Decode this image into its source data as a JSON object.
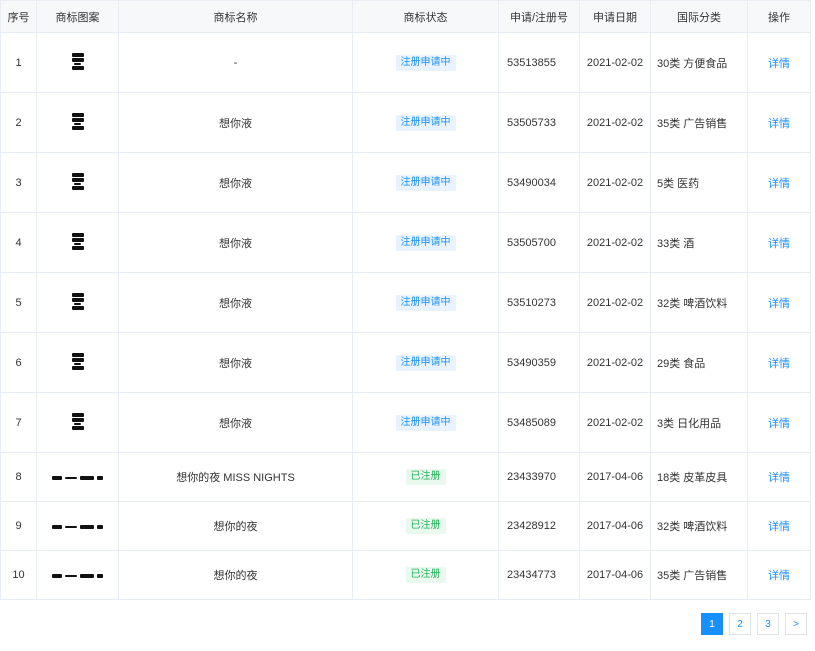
{
  "table": {
    "headers": [
      "序号",
      "商标图案",
      "商标名称",
      "商标状态",
      "申请/注册号",
      "申请日期",
      "国际分类",
      "操作"
    ],
    "rows": [
      {
        "index": "1",
        "logo": "vertical-text-logo",
        "name": "-",
        "status": "注册申请中",
        "status_type": "pending",
        "number": "53513855",
        "date": "2021-02-02",
        "category": "30类 方便食品",
        "action": "详情"
      },
      {
        "index": "2",
        "logo": "vertical-text-logo",
        "name": "想你液",
        "status": "注册申请中",
        "status_type": "pending",
        "number": "53505733",
        "date": "2021-02-02",
        "category": "35类 广告销售",
        "action": "详情"
      },
      {
        "index": "3",
        "logo": "vertical-text-logo",
        "name": "想你液",
        "status": "注册申请中",
        "status_type": "pending",
        "number": "53490034",
        "date": "2021-02-02",
        "category": "5类 医药",
        "action": "详情"
      },
      {
        "index": "4",
        "logo": "vertical-text-logo",
        "name": "想你液",
        "status": "注册申请中",
        "status_type": "pending",
        "number": "53505700",
        "date": "2021-02-02",
        "category": "33类 酒",
        "action": "详情"
      },
      {
        "index": "5",
        "logo": "vertical-text-logo",
        "name": "想你液",
        "status": "注册申请中",
        "status_type": "pending",
        "number": "53510273",
        "date": "2021-02-02",
        "category": "32类 啤酒饮料",
        "action": "详情"
      },
      {
        "index": "6",
        "logo": "vertical-text-logo",
        "name": "想你液",
        "status": "注册申请中",
        "status_type": "pending",
        "number": "53490359",
        "date": "2021-02-02",
        "category": "29类 食品",
        "action": "详情"
      },
      {
        "index": "7",
        "logo": "vertical-text-logo",
        "name": "想你液",
        "status": "注册申请中",
        "status_type": "pending",
        "number": "53485089",
        "date": "2021-02-02",
        "category": "3类 日化用品",
        "action": "详情"
      },
      {
        "index": "8",
        "logo": "horizontal-text-logo",
        "name": "想你的夜 MISS NIGHTS",
        "status": "已注册",
        "status_type": "registered",
        "number": "23433970",
        "date": "2017-04-06",
        "category": "18类 皮革皮具",
        "action": "详情"
      },
      {
        "index": "9",
        "logo": "horizontal-text-logo",
        "name": "想你的夜",
        "status": "已注册",
        "status_type": "registered",
        "number": "23428912",
        "date": "2017-04-06",
        "category": "32类 啤酒饮料",
        "action": "详情"
      },
      {
        "index": "10",
        "logo": "horizontal-text-logo",
        "name": "想你的夜",
        "status": "已注册",
        "status_type": "registered",
        "number": "23434773",
        "date": "2017-04-06",
        "category": "35类 广告销售",
        "action": "详情"
      }
    ]
  },
  "pagination": {
    "pages": [
      "1",
      "2",
      "3"
    ],
    "current": "1",
    "next": ">"
  },
  "colors": {
    "accent": "#1890ff",
    "pending_bg": "#e8f3ff",
    "registered_text": "#20b45a",
    "registered_bg": "#e9f9ee"
  }
}
